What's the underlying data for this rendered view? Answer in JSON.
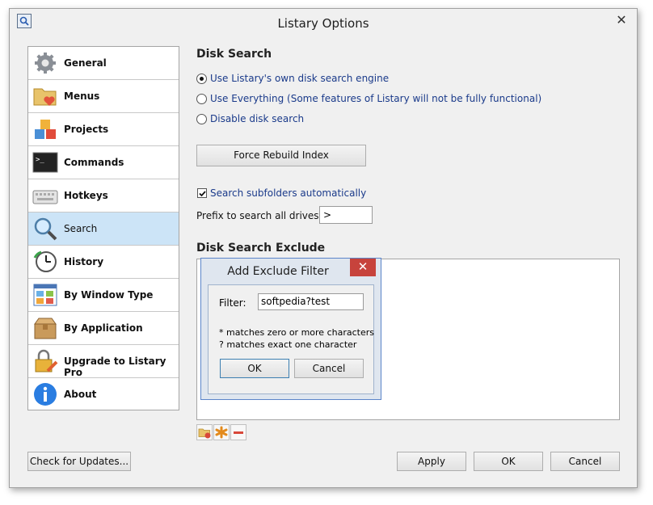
{
  "window": {
    "title": "Listary Options",
    "close_glyph": "✕"
  },
  "sidebar": {
    "items": [
      {
        "label": "General",
        "icon": "gear-icon"
      },
      {
        "label": "Menus",
        "icon": "folder-heart-icon"
      },
      {
        "label": "Projects",
        "icon": "cubes-icon"
      },
      {
        "label": "Commands",
        "icon": "terminal-icon"
      },
      {
        "label": "Hotkeys",
        "icon": "keyboard-icon"
      },
      {
        "label": "Search",
        "icon": "magnifier-icon"
      },
      {
        "label": "History",
        "icon": "clock-icon"
      },
      {
        "label": "By Window Type",
        "icon": "window-grid-icon"
      },
      {
        "label": "By Application",
        "icon": "package-icon"
      },
      {
        "label": "Upgrade to Listary Pro",
        "icon": "lock-pencil-icon"
      },
      {
        "label": "About",
        "icon": "info-icon"
      }
    ],
    "selected": "Search"
  },
  "disk_search": {
    "title": "Disk Search",
    "options": [
      {
        "label": "Use Listary's own disk search engine",
        "checked": true
      },
      {
        "label": "Use Everything (Some features of Listary will not be fully functional)",
        "checked": false
      },
      {
        "label": "Disable disk search",
        "checked": false
      }
    ],
    "rebuild_label": "Force Rebuild Index",
    "subfolders_label": "Search subfolders automatically",
    "subfolders_checked": true,
    "prefix_label": "Prefix to search all drives:",
    "prefix_value": ">"
  },
  "exclude": {
    "title": "Disk Search Exclude",
    "items": []
  },
  "dialog": {
    "title": "Add Exclude Filter",
    "filter_label": "Filter:",
    "filter_value": "softpedia?test",
    "hint_1": "* matches zero or more characters",
    "hint_2": "? matches exact one character",
    "ok_label": "OK",
    "cancel_label": "Cancel",
    "close_glyph": "✕"
  },
  "footer": {
    "check_updates_label": "Check for Updates...",
    "apply_label": "Apply",
    "ok_label": "OK",
    "cancel_label": "Cancel"
  },
  "colors": {
    "accent": "#cce4f7",
    "link_text": "#1a3a8a",
    "dialog_close": "#c7433c"
  }
}
